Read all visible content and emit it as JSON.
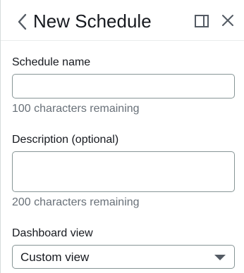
{
  "header": {
    "title": "New Schedule",
    "back_icon": "chevron-left-icon",
    "panel_icon": "split-panel-icon",
    "close_icon": "close-icon"
  },
  "form": {
    "schedule_name": {
      "label": "Schedule name",
      "value": "",
      "hint": "100 characters remaining"
    },
    "description": {
      "label": "Description (optional)",
      "value": "",
      "hint": "200 characters remaining"
    },
    "dashboard_view": {
      "label": "Dashboard view",
      "selected": "Custom view"
    }
  },
  "colors": {
    "text": "#16191f",
    "hint": "#687078",
    "border": "#879596",
    "icon": "#545b64"
  }
}
